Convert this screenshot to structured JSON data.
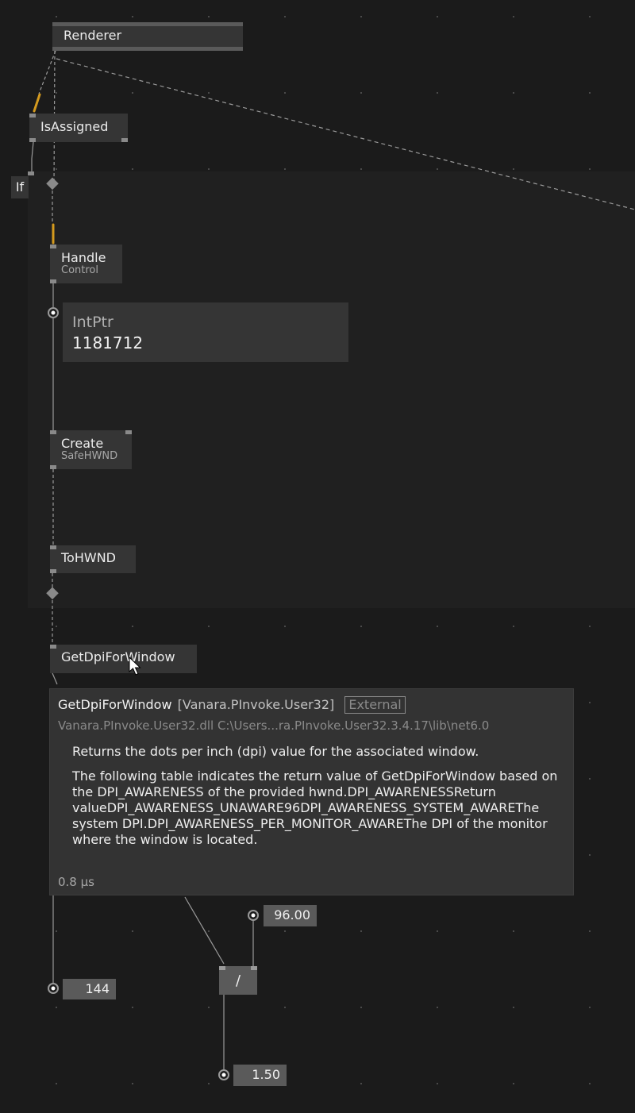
{
  "nodes": {
    "renderer": {
      "title": "Renderer"
    },
    "is_assigned": {
      "title": "IsAssigned"
    },
    "if": {
      "title": "If"
    },
    "handle": {
      "title": "Handle",
      "subtitle": "Control"
    },
    "create": {
      "title": "Create",
      "subtitle": "SafeHWND"
    },
    "to_hwnd": {
      "title": "ToHWND"
    },
    "get_dpi": {
      "title": "GetDpiForWindow"
    },
    "divide": {
      "title": "/"
    }
  },
  "value_box": {
    "type": "IntPtr",
    "value": "1181712"
  },
  "io_boxes": {
    "dpi": "144",
    "const": "96.00",
    "result": "1.50"
  },
  "tooltip": {
    "name": "GetDpiForWindow",
    "namespace": "[Vanara.PInvoke.User32]",
    "badge": "External",
    "path": "Vanara.PInvoke.User32.dll  C:\\Users...ra.PInvoke.User32.3.4.17\\lib\\net6.0",
    "summary": "Returns the dots per inch (dpi) value for the associated window.",
    "remarks": "The following table indicates the return value of GetDpiForWindow based on the DPI_AWARENESS of the provided hwnd.DPI_AWARENESSReturn valueDPI_AWARENESS_UNAWARE96DPI_AWARENESS_SYSTEM_AWAREThe system DPI.DPI_AWARENESS_PER_MONITOR_AWAREThe DPI of the monitor where the window is located.",
    "timing": "0.8 µs"
  },
  "colors": {
    "background": "#1b1b1b",
    "region": "#202020",
    "node": "#353535",
    "iobox": "#5a5a5a",
    "link": "#9a9a9a",
    "highlight": "#d49a1e"
  }
}
